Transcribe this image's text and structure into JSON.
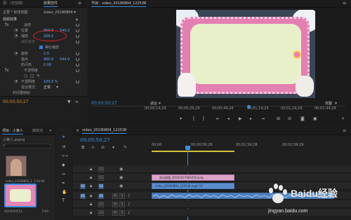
{
  "effects": {
    "tab_source": "源：(无剪辑)",
    "tab_effects": "效果控件",
    "source_label": "主要 * 徐佳制图",
    "clip_label": "video_20190804",
    "section_video": "视频效果",
    "motion": "运动",
    "position_label": "位置",
    "position_x": "960.0",
    "position_y": "540.0",
    "scale_label": "缩放",
    "scale_value": "208.0",
    "scale_width_label": "缩放宽度",
    "uniform_label": "等比缩放",
    "rotation_label": "旋转",
    "rotation_value": "0.0",
    "anchor_label": "锚点",
    "anchor_x": "960.0",
    "anchor_y": "544.0",
    "flicker_label": "防闪烁",
    "flicker_value": "0.00",
    "opacity_section": "不透明度",
    "opacity_label": "不透明度",
    "opacity_value": "100.0 %",
    "blend_label": "混合模式",
    "blend_value": "正常",
    "time_remap": "时间重映射",
    "timecode": "00;00;50;27"
  },
  "program": {
    "title": "节目：video_20190804_122538",
    "timecode": "00;00;50;27",
    "fit": "适合",
    "ruler_times": [
      "00;00;14;29",
      "00;00;29;29",
      "00;00;44;28",
      "00;01;14;29",
      "00;01;29;29",
      "00;01;44;28"
    ],
    "quality": "完整"
  },
  "project": {
    "tab_project": "项目：小黄人",
    "tab_lib": "媒体浏",
    "project_name": "小黄人.prproj",
    "item1_label": "video_20190804_1",
    "item1_dur": "1:50:06",
    "item2_label": "2020050512...",
    "item2_dur": "5:00"
  },
  "timeline": {
    "title": "video_20190804_122538",
    "timecode": "00;00;50;27",
    "ruler_times": [
      "00;00",
      "00;00;59;28",
      "00;01;59;28",
      "00;02;59;29"
    ],
    "tracks": [
      "V3",
      "V2",
      "V1",
      "A1",
      "A2",
      "A3"
    ],
    "clip_v2": "双击插图_20201027081650.png",
    "clip_v1": "video_20190804_122538.mp4 [V]"
  },
  "watermark": {
    "brand": "Baidu经验",
    "url": "jingyan.baidu.com"
  },
  "colors": {
    "accent_blue": "#3a8fe0",
    "value_blue": "#5aa9ff",
    "timecode_orange": "#d88a30",
    "clip_pink": "#d9a3c8",
    "clip_blue": "#5b8fcf",
    "audio_green": "#7aa7d9",
    "annotation_red": "#e02020"
  }
}
